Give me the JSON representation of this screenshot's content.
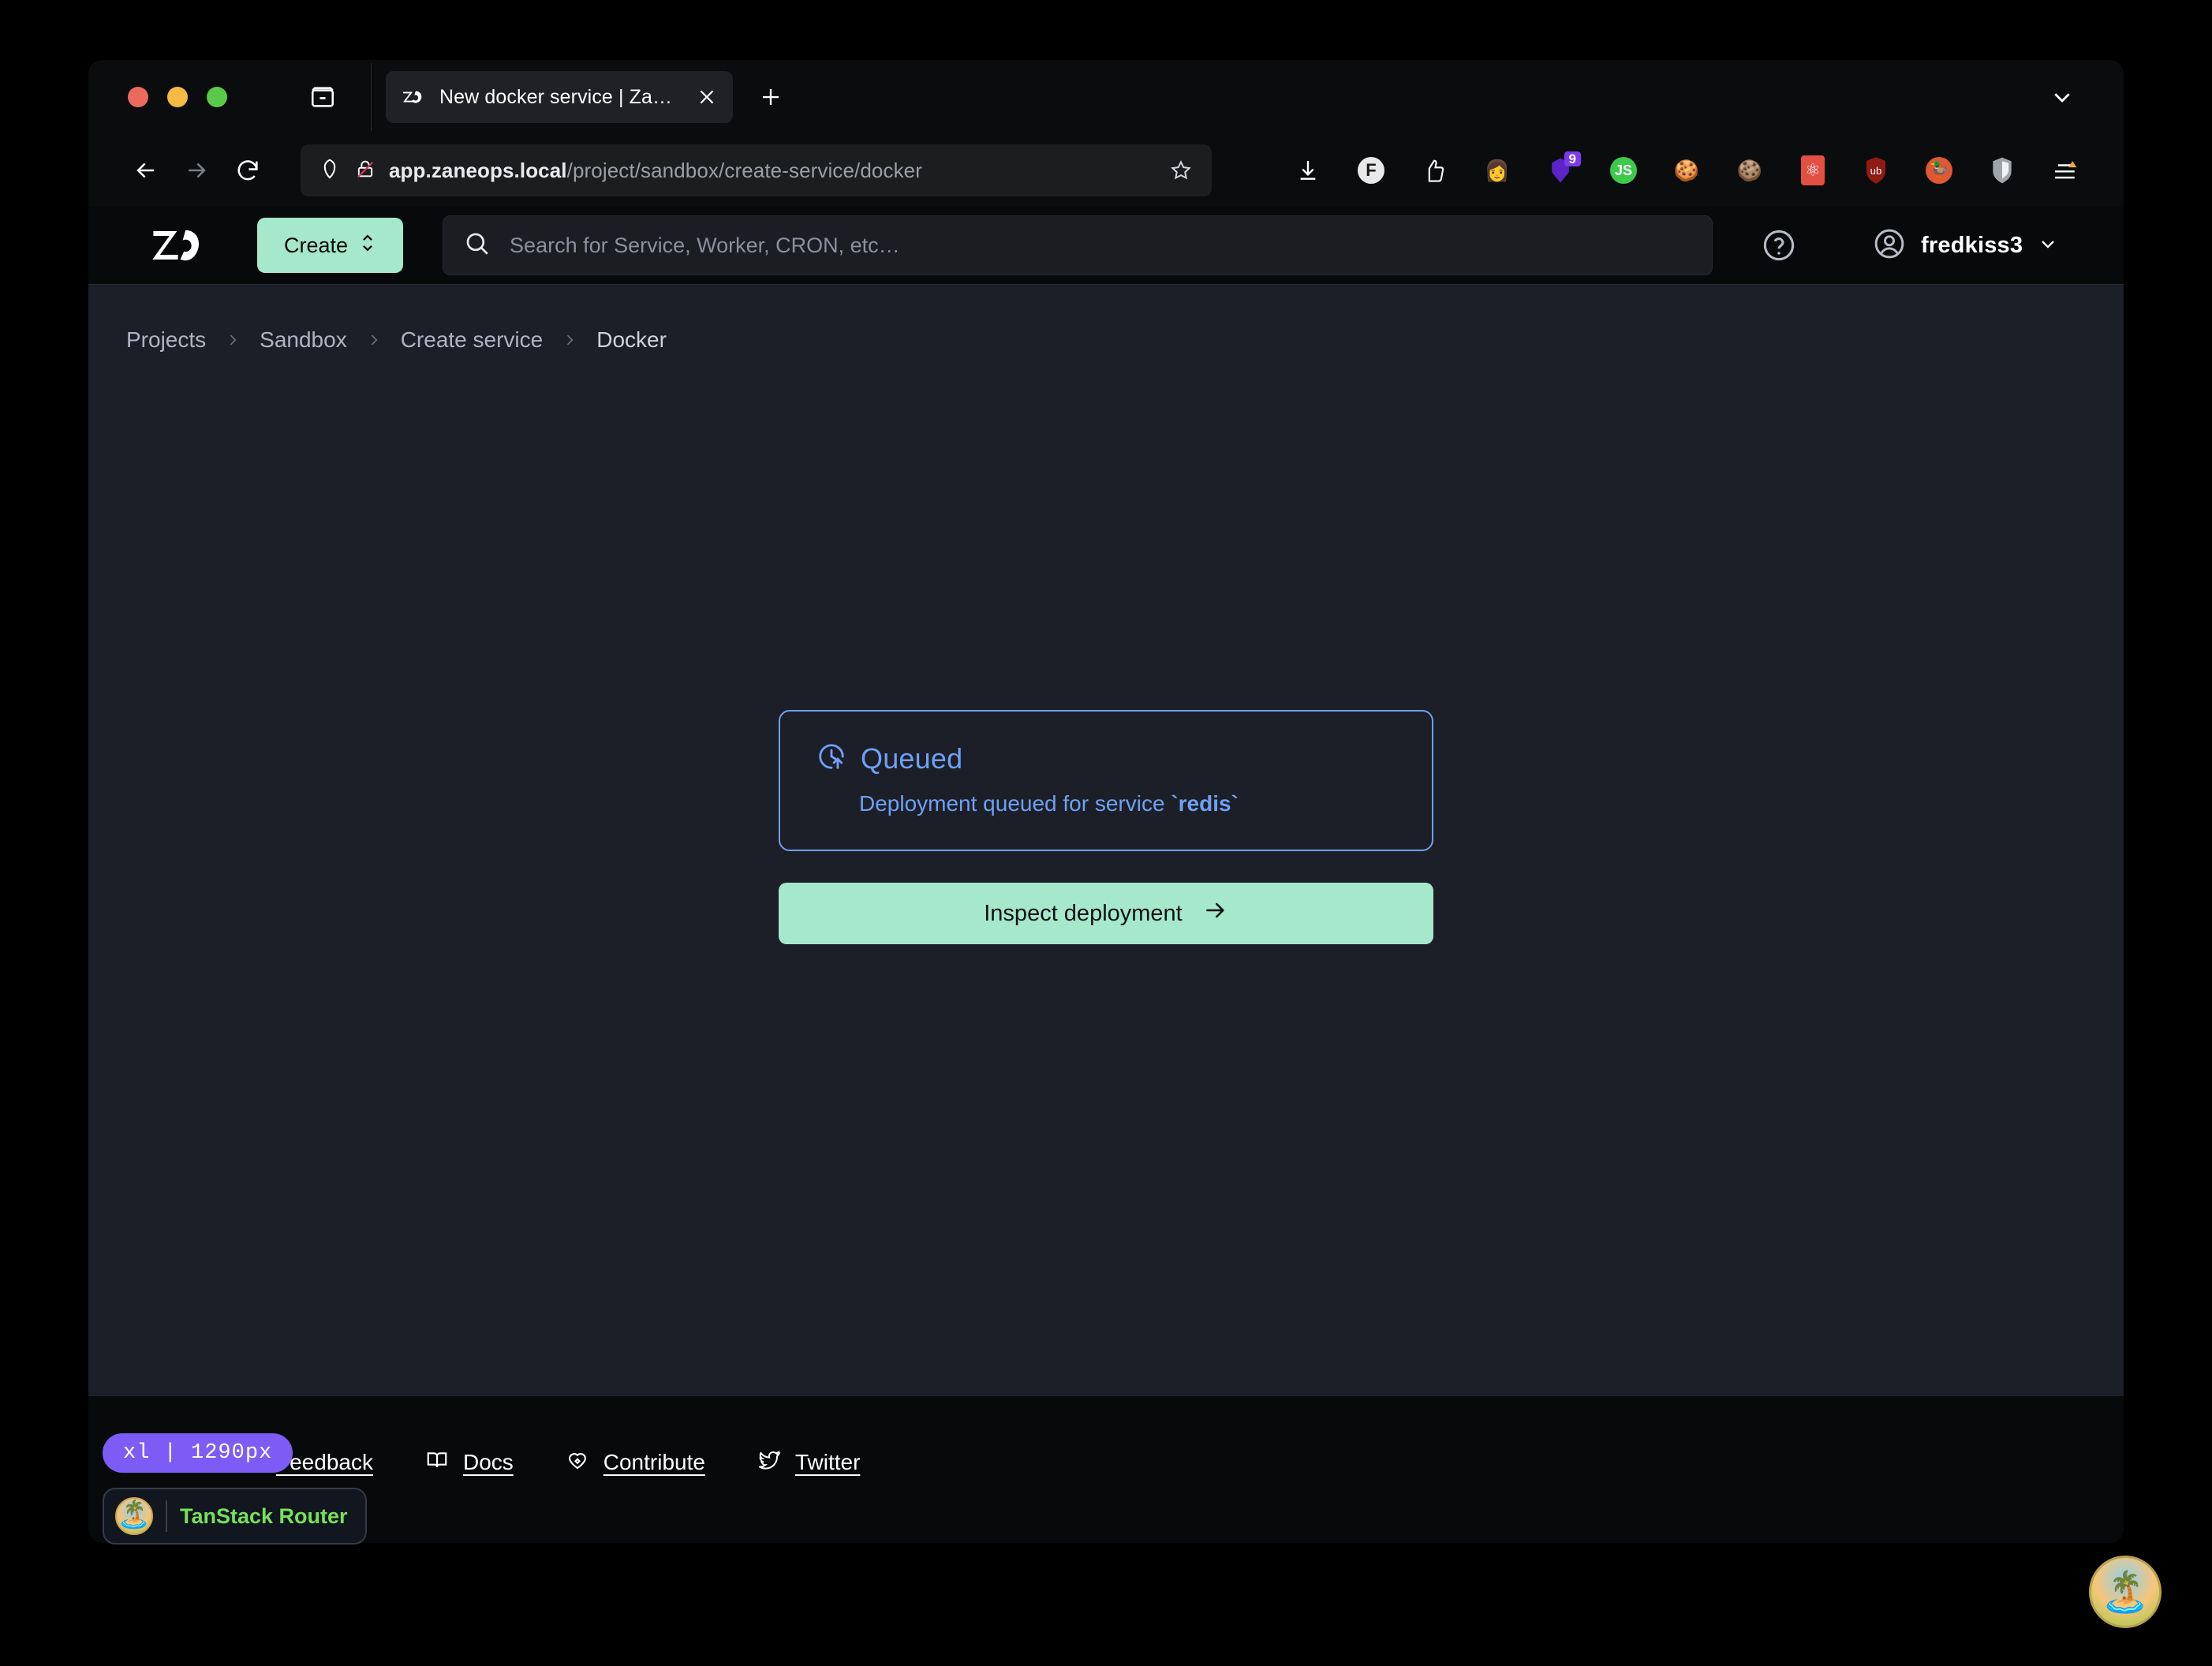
{
  "browser": {
    "window_controls": [
      "close",
      "minimize",
      "maximize"
    ],
    "sidebar_toggle_icon": "sidebar-icon",
    "collapse_icon": "chevron-down-icon",
    "tab": {
      "favicon": "zaneops-favicon",
      "title": "New docker service | ZaneOps",
      "close_icon": "close-icon"
    },
    "new_tab_icon": "plus-icon",
    "nav": {
      "back_icon": "arrow-left-icon",
      "forward_icon": "arrow-right-icon",
      "reload_icon": "reload-icon"
    },
    "address_bar": {
      "shield_icon": "shield-icon",
      "lock_icon": "lock-broken-icon",
      "url_host": "app.zaneops.local",
      "url_path": "/project/sandbox/create-service/docker",
      "bookmark_icon": "star-icon"
    },
    "extensions": [
      {
        "name": "downloads-icon",
        "glyph": "⤓",
        "color": "#ffffff"
      },
      {
        "name": "facebook-container-icon",
        "glyph": "F",
        "color": "#ffffff",
        "bg": "#e8e8e8",
        "fg": "#111111"
      },
      {
        "name": "sponsorblock-icon",
        "glyph": "👍",
        "color": "#ffffff"
      },
      {
        "name": "avatar-extension-icon",
        "glyph": "👩",
        "color": "#ffffff"
      },
      {
        "name": "bitwarden-icon",
        "glyph": "▼",
        "color": "#6e2fd8",
        "badge": "9"
      },
      {
        "name": "javascript-toggle-icon",
        "glyph": "JS",
        "bg": "#3ec94c",
        "fg": "#ffffff"
      },
      {
        "name": "cookie-manager-icon",
        "glyph": "🍪",
        "color": "#e0a44a"
      },
      {
        "name": "cookie-autodelete-icon",
        "glyph": "🍪",
        "color": "#b59270"
      },
      {
        "name": "react-devtools-icon",
        "glyph": "⚛",
        "bg": "#e34f42",
        "fg": "#ffffff"
      },
      {
        "name": "ublock-origin-icon",
        "glyph": "ub",
        "bg": "#8f1b14",
        "fg": "#ffffff"
      },
      {
        "name": "duckduckgo-privacy-icon",
        "glyph": "🦆",
        "bg": "#de5833",
        "fg": "#ffffff"
      },
      {
        "name": "privacy-badger-icon",
        "glyph": "🛡",
        "bg": "#9ea3a8",
        "fg": "#ffffff"
      },
      {
        "name": "menu-icon",
        "glyph": "≡",
        "color": "#ffffff"
      }
    ]
  },
  "app_header": {
    "logo": "zaneops-logo",
    "create_label": "Create",
    "create_icon": "chevron-up-down-icon",
    "search_icon": "search-icon",
    "search_placeholder": "Search for Service, Worker, CRON, etc…",
    "search_value": "",
    "help_icon": "question-circle-icon",
    "user_icon": "user-circle-icon",
    "username": "fredkiss3",
    "user_caret_icon": "chevron-down-icon"
  },
  "breadcrumb": {
    "items": [
      {
        "label": "Projects",
        "current": false
      },
      {
        "label": "Sandbox",
        "current": false
      },
      {
        "label": "Create service",
        "current": false
      },
      {
        "label": "Docker",
        "current": true
      }
    ],
    "separator": "›"
  },
  "main": {
    "status_card": {
      "icon": "clock-arrow-up-icon",
      "title": "Queued",
      "description_prefix": "Deployment queued for service ",
      "description_code": "`redis`",
      "accent_color": "#6fa0f5"
    },
    "inspect_button": {
      "label": "Inspect deployment",
      "icon": "arrow-right-icon",
      "color": "#a5e8cb"
    }
  },
  "footer": {
    "links": [
      {
        "label": "Feedback",
        "icon": "send-icon"
      },
      {
        "label": "Docs",
        "icon": "book-open-icon"
      },
      {
        "label": "Contribute",
        "icon": "heart-handshake-icon"
      },
      {
        "label": "Twitter",
        "icon": "twitter-icon"
      }
    ],
    "breakpoint_badge": "xl | 1290px",
    "tanstack_badge": {
      "label": "TanStack Router",
      "logo": "tanstack-logo"
    },
    "tanstack_fab": "tanstack-devtools-fab"
  }
}
